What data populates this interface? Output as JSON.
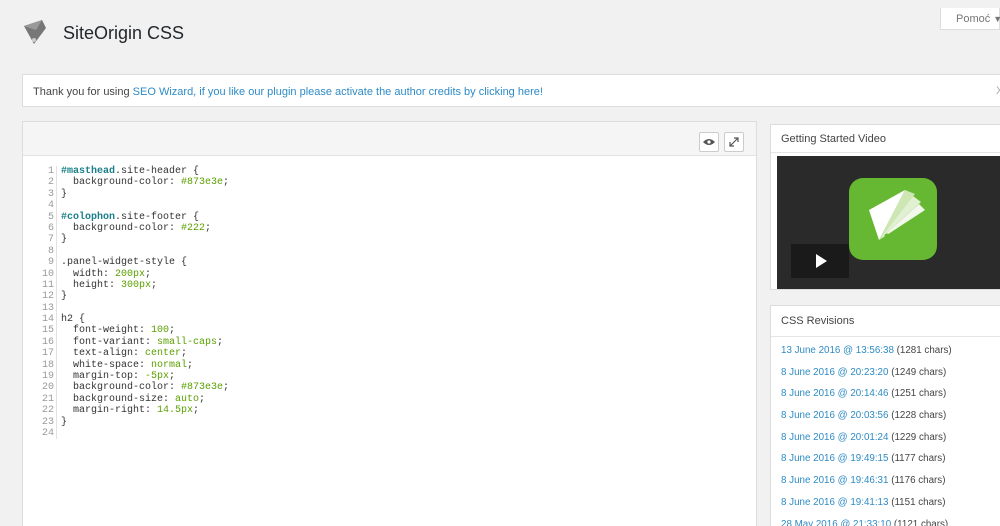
{
  "help_tab": {
    "label": "Pomoć"
  },
  "header": {
    "title": "SiteOrigin CSS"
  },
  "notice": {
    "text_before": "Thank you for using ",
    "link_text": "SEO Wizard, if you like our plugin please activate the author credits by clicking here!",
    "dismiss": "X"
  },
  "editor": {
    "toolbar": {
      "preview_icon": "eye-icon",
      "expand_icon": "expand-icon"
    },
    "lines": [
      [
        {
          "t": "#masthead",
          "c": "id"
        },
        {
          "t": ".site-header {"
        }
      ],
      [
        {
          "t": "  background-color: "
        },
        {
          "t": "#873e3e",
          "c": "val"
        },
        {
          "t": ";"
        }
      ],
      [
        {
          "t": "}"
        }
      ],
      [],
      [
        {
          "t": "#colophon",
          "c": "id"
        },
        {
          "t": ".site-footer {"
        }
      ],
      [
        {
          "t": "  background-color: "
        },
        {
          "t": "#222",
          "c": "val"
        },
        {
          "t": ";"
        }
      ],
      [
        {
          "t": "}"
        }
      ],
      [],
      [
        {
          "t": ".panel-widget-style {"
        }
      ],
      [
        {
          "t": "  width: "
        },
        {
          "t": "200px",
          "c": "val"
        },
        {
          "t": ";"
        }
      ],
      [
        {
          "t": "  height: "
        },
        {
          "t": "300px",
          "c": "val"
        },
        {
          "t": ";"
        }
      ],
      [
        {
          "t": "}"
        }
      ],
      [],
      [
        {
          "t": "h2 {"
        }
      ],
      [
        {
          "t": "  font-weight: "
        },
        {
          "t": "100",
          "c": "val"
        },
        {
          "t": ";"
        }
      ],
      [
        {
          "t": "  font-variant: "
        },
        {
          "t": "small-caps",
          "c": "val"
        },
        {
          "t": ";"
        }
      ],
      [
        {
          "t": "  text-align: "
        },
        {
          "t": "center",
          "c": "val"
        },
        {
          "t": ";"
        }
      ],
      [
        {
          "t": "  white-space: "
        },
        {
          "t": "normal",
          "c": "val"
        },
        {
          "t": ";"
        }
      ],
      [
        {
          "t": "  margin-top: "
        },
        {
          "t": "-5px",
          "c": "val"
        },
        {
          "t": ";"
        }
      ],
      [
        {
          "t": "  background-color: "
        },
        {
          "t": "#873e3e",
          "c": "val"
        },
        {
          "t": ";"
        }
      ],
      [
        {
          "t": "  background-size: "
        },
        {
          "t": "auto",
          "c": "val"
        },
        {
          "t": ";"
        }
      ],
      [
        {
          "t": "  margin-right: "
        },
        {
          "t": "14.5px",
          "c": "val"
        },
        {
          "t": ";"
        }
      ],
      [
        {
          "t": "}"
        }
      ],
      []
    ]
  },
  "video_box": {
    "title": "Getting Started Video"
  },
  "revisions": {
    "title": "CSS Revisions",
    "items": [
      {
        "date": "13 June 2016 @ 13:56:38",
        "chars": "(1281 chars)"
      },
      {
        "date": "8 June 2016 @ 20:23:20",
        "chars": "(1249 chars)"
      },
      {
        "date": "8 June 2016 @ 20:14:46",
        "chars": "(1251 chars)"
      },
      {
        "date": "8 June 2016 @ 20:03:56",
        "chars": "(1228 chars)"
      },
      {
        "date": "8 June 2016 @ 20:01:24",
        "chars": "(1229 chars)"
      },
      {
        "date": "8 June 2016 @ 19:49:15",
        "chars": "(1177 chars)"
      },
      {
        "date": "8 June 2016 @ 19:46:31",
        "chars": "(1176 chars)"
      },
      {
        "date": "8 June 2016 @ 19:41:13",
        "chars": "(1151 chars)"
      },
      {
        "date": "28 May 2016 @ 21:33:10",
        "chars": "(1121 chars)"
      }
    ]
  },
  "colors": {
    "accent_link": "#2e8bc4",
    "code_id": "#1a7f8a",
    "code_value": "#5ba000",
    "video_icon": "#66b832"
  }
}
